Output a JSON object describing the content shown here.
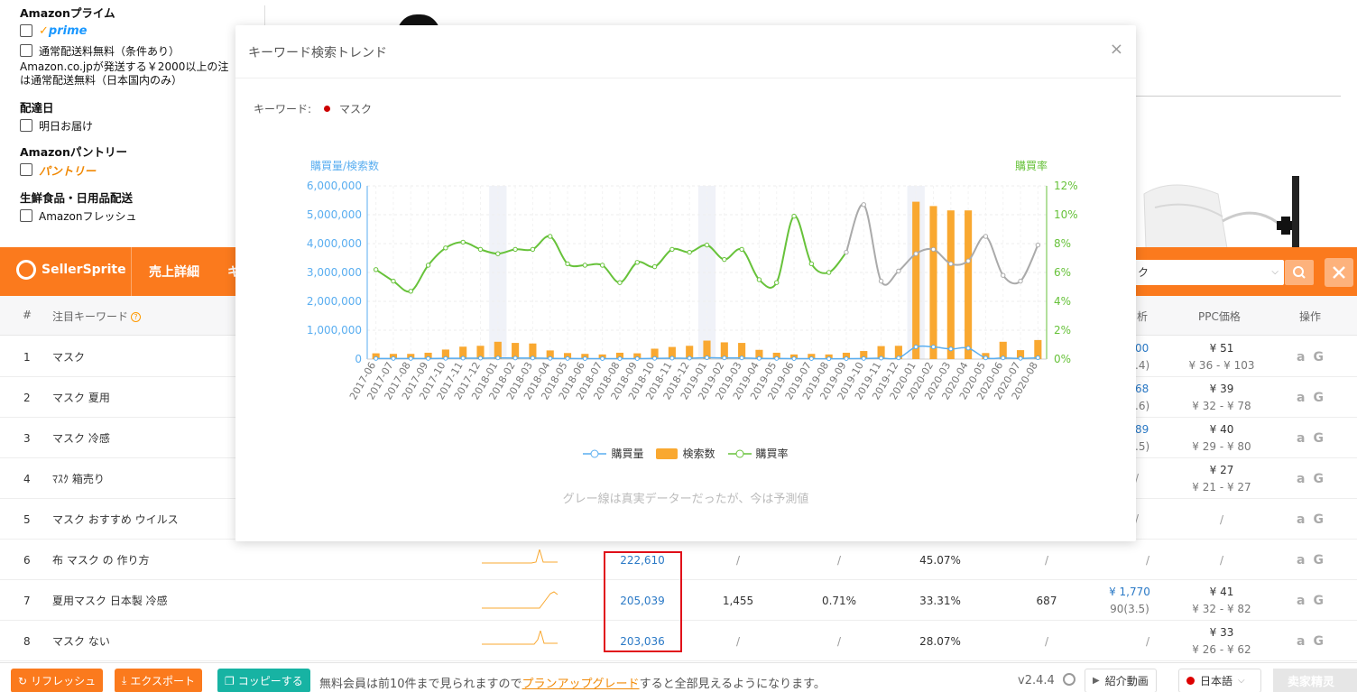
{
  "filters": {
    "prime_title": "Amazonプライム",
    "prime_logo": "prime",
    "free_shipping": "通常配送料無料（条件あり）",
    "free_shipping_note1": "Amazon.co.jpが発送する￥2000以上の注",
    "free_shipping_note2": "は通常配送無料（日本国内のみ）",
    "delivery_title": "配達日",
    "tomorrow": "明日お届け",
    "pantry_title": "Amazonパントリー",
    "pantry_logo": "パントリー",
    "fresh_title": "生鮮食品・日用品配送",
    "fresh": "Amazonフレッシュ"
  },
  "sellersprite": {
    "logo": "SellerSprite",
    "tab1": "売上詳細",
    "tab2": "キ",
    "search_value": "ク"
  },
  "table": {
    "headers": {
      "num": "#",
      "keyword": "注目キーワード",
      "analysis": "析",
      "ppc": "PPC価格",
      "ops": "操作"
    },
    "rows": [
      {
        "n": "1",
        "kw": "マスク",
        "a_top": "00",
        "a_bot": ".4)",
        "ppc": "¥ 51",
        "ppc_range": "¥ 36 - ¥ 103"
      },
      {
        "n": "2",
        "kw": "マスク 夏用",
        "a_top": "68",
        "a_bot": ".6)",
        "ppc": "¥ 39",
        "ppc_range": "¥ 32 - ¥ 78"
      },
      {
        "n": "3",
        "kw": "マスク 冷感",
        "a_top": "89",
        "a_bot": ".5)",
        "ppc": "¥ 40",
        "ppc_range": "¥ 29 - ¥ 80"
      },
      {
        "n": "4",
        "kw": "ﾏｽｸ 箱売り",
        "a_top": "/",
        "a_bot": "",
        "ppc": "¥ 27",
        "ppc_range": "¥ 21 - ¥ 27"
      },
      {
        "n": "5",
        "kw": "マスク おすすめ ウイルス",
        "a_top": "/",
        "a_bot": "",
        "ppc": "/",
        "ppc_range": ""
      },
      {
        "n": "6",
        "kw": "布 マスク の 作り方",
        "vol": "222,610",
        "c4": "/",
        "c5": "/",
        "c6": "45.07%",
        "c7": "/",
        "c8": "/",
        "ppc": "/",
        "ppc_range": ""
      },
      {
        "n": "7",
        "kw": "夏用マスク 日本製 冷感",
        "vol": "205,039",
        "c4": "1,455",
        "c5": "0.71%",
        "c6": "33.31%",
        "c7": "687",
        "c8": "¥ 1,770",
        "c8b": "90(3.5)",
        "ppc": "¥ 41",
        "ppc_range": "¥ 32 - ¥ 82"
      },
      {
        "n": "8",
        "kw": "マスク ない",
        "vol": "203,036",
        "c4": "/",
        "c5": "/",
        "c6": "28.07%",
        "c7": "/",
        "c8": "/",
        "ppc": "¥ 33",
        "ppc_range": "¥ 26 - ¥ 62"
      }
    ]
  },
  "footer": {
    "refresh": "リフレッシュ",
    "export": "エクスポート",
    "copy": "コッピーする",
    "msg_pre": "無料会員は前10件まで見られますので",
    "msg_link": "プランアップグレード",
    "msg_post": "すると全部見えるようになります。",
    "version": "v2.4.4",
    "intro": "紹介動画",
    "lang": "日本語",
    "shop": "卖家精灵"
  },
  "modal": {
    "title": "キーワード検索トレンド",
    "keyword_label": "キーワード:",
    "keyword": "マスク",
    "note": "グレー線は真実データーだったが、今は予測値"
  },
  "colors": {
    "orange": "#fb7a1d",
    "bar": "#f9a830",
    "rate_line": "#67c23a",
    "volume_line": "#5aaef0",
    "forecast_line": "#aaaaaa"
  },
  "chart_data": {
    "type": "bar",
    "left_axis_label": "購買量/検索数",
    "right_axis_label": "購買率",
    "y_left_ticks": [
      "0",
      "1,000,000",
      "2,000,000",
      "3,000,000",
      "4,000,000",
      "5,000,000",
      "6,000,000"
    ],
    "y_right_ticks": [
      "0%",
      "2%",
      "4%",
      "6%",
      "8%",
      "10%",
      "12%"
    ],
    "ylim_left": [
      0,
      6000000
    ],
    "ylim_right": [
      0,
      12
    ],
    "categories": [
      "2017-06",
      "2017-07",
      "2017-08",
      "2017-09",
      "2017-10",
      "2017-11",
      "2017-12",
      "2018-01",
      "2018-02",
      "2018-03",
      "2018-04",
      "2018-05",
      "2018-06",
      "2018-07",
      "2018-08",
      "2018-09",
      "2018-10",
      "2018-11",
      "2018-12",
      "2019-01",
      "2019-02",
      "2019-03",
      "2019-04",
      "2019-05",
      "2019-06",
      "2019-07",
      "2019-08",
      "2019-09",
      "2019-10",
      "2019-11",
      "2019-12",
      "2020-01",
      "2020-02",
      "2020-03",
      "2020-04",
      "2020-05",
      "2020-06",
      "2020-07",
      "2020-08"
    ],
    "highlight_categories": [
      "2018-01",
      "2019-01",
      "2020-01"
    ],
    "series": [
      {
        "name": "購買量",
        "kind": "line",
        "axis": "left",
        "values": [
          20000,
          20000,
          20000,
          20000,
          25000,
          30000,
          30000,
          40000,
          35000,
          35000,
          25000,
          20000,
          15000,
          15000,
          15000,
          15000,
          25000,
          30000,
          30000,
          45000,
          40000,
          40000,
          25000,
          20000,
          15000,
          15000,
          10000,
          15000,
          20000,
          30000,
          40000,
          420000,
          420000,
          350000,
          380000,
          40000,
          40000,
          25000,
          45000
        ]
      },
      {
        "name": "検索数",
        "kind": "bar",
        "axis": "left",
        "values": [
          200000,
          180000,
          180000,
          220000,
          330000,
          430000,
          460000,
          600000,
          560000,
          540000,
          300000,
          210000,
          180000,
          160000,
          220000,
          200000,
          360000,
          420000,
          460000,
          640000,
          580000,
          560000,
          320000,
          220000,
          160000,
          180000,
          160000,
          220000,
          280000,
          450000,
          460000,
          5450000,
          5300000,
          5150000,
          5150000,
          210000,
          600000,
          310000,
          660000
        ]
      },
      {
        "name": "購買率",
        "kind": "line",
        "axis": "right",
        "values": [
          6.2,
          5.4,
          4.7,
          6.5,
          7.7,
          8.1,
          7.6,
          7.3,
          7.6,
          7.6,
          8.5,
          6.6,
          6.5,
          6.5,
          5.3,
          6.7,
          6.4,
          7.6,
          7.4,
          7.9,
          6.9,
          7.6,
          5.5,
          5.3,
          9.9,
          6.6,
          6.0,
          7.4,
          10.7,
          5.4,
          6.1,
          7.3,
          7.6,
          6.6,
          6.8,
          8.5,
          5.8,
          5.4,
          7.9
        ],
        "forecast_from_index": 27
      }
    ],
    "legend": [
      "購買量",
      "検索数",
      "購買率"
    ],
    "legend_position": "bottom",
    "grid": true
  }
}
